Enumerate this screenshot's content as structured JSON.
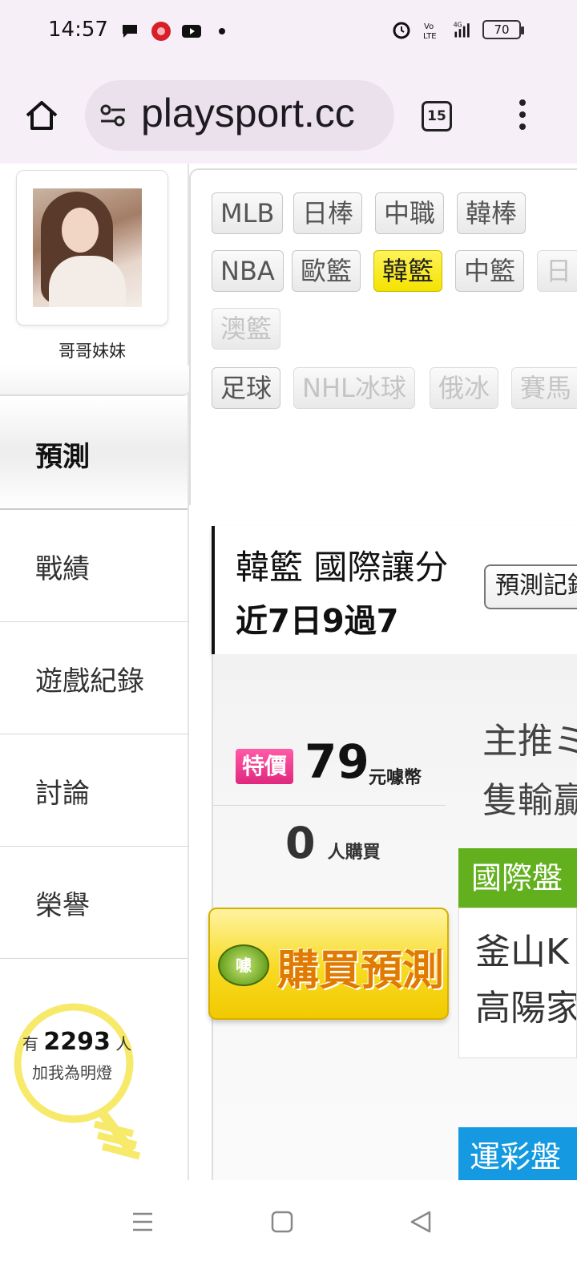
{
  "status_bar": {
    "time": "14:57",
    "battery": "70",
    "icons_left": [
      "chat-bubble-icon",
      "red-app-icon",
      "youtube-icon",
      "dot-icon"
    ],
    "icons_right": [
      "alarm-icon",
      "volte-icon",
      "signal-4g-icon",
      "battery-icon"
    ]
  },
  "browser": {
    "url": "playsport.cc",
    "tab_count": "15"
  },
  "profile": {
    "nickname": "哥哥妹妹"
  },
  "sidebar": {
    "items": [
      {
        "label": "預測",
        "active": true
      },
      {
        "label": "戰績"
      },
      {
        "label": "遊戲紀錄"
      },
      {
        "label": "討論"
      },
      {
        "label": "榮譽"
      }
    ],
    "bulb": {
      "prefix": "有",
      "count": "2293",
      "suffix": "人",
      "line2": "加我為明燈"
    }
  },
  "categories": {
    "row1": [
      "MLB",
      "日棒",
      "中職",
      "韓棒"
    ],
    "row2": [
      "NBA",
      "歐籃",
      "韓籃",
      "中籃",
      "日"
    ],
    "row3": [
      "澳籃"
    ],
    "row4": [
      "足球",
      "NHL冰球",
      "俄冰",
      "賽馬"
    ]
  },
  "prediction": {
    "title": "韓籃 國際讓分",
    "record": "近7日9過7",
    "record_button": "預測記錄"
  },
  "purchase": {
    "badge": "特價",
    "price": "79",
    "unit": "元噱幣",
    "buyers": "0",
    "buyers_label": "人購買",
    "button_label": "購買預測",
    "coin_label": "噱"
  },
  "right_column": {
    "rec_line1": "主推ミ",
    "rec_line2": "隻輸贏",
    "green_tab": "國際盤",
    "team1": "釜山K",
    "team2": "高陽家",
    "blue_tab": "運彩盤"
  },
  "colors": {
    "active_tag": "#f4e200",
    "green_tab": "#62b01e",
    "blue_tab": "#1599e0",
    "special_badge": "#e0287e",
    "buy_button": "#f8da22",
    "bulb": "#f7e96a"
  }
}
